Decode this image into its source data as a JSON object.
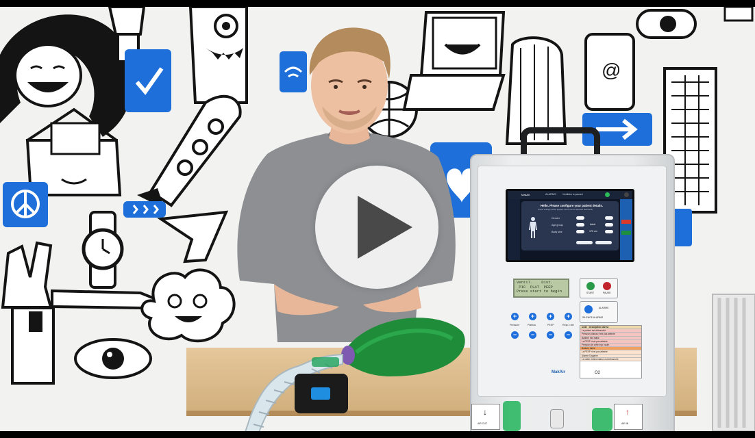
{
  "video": {
    "play_button_label": "Play video"
  },
  "device": {
    "screen": {
      "header_brand": "MakAir",
      "header_mode": "ALARMS",
      "header_status": "Ventilator is paused",
      "dialog_title": "Hello. Please configure your patient details.",
      "dialog_sub": "Preset settings will be applied, which can be adjusted afterwards.",
      "rows": [
        "Gender",
        "Age group",
        "Body size"
      ],
      "values": [
        "Adult",
        "170 cm"
      ]
    },
    "lcd_text": "Ventil.    Dist.\n PIC  PLAT  PEEP\nPress start to begin",
    "buttons": {
      "start_label": "START",
      "pause_label": "PAUSE",
      "alarms_label": "ALARMS",
      "silence_label": "SILENCE ALARMS"
    },
    "knobs": [
      "Pressure",
      "Plateau",
      "PEEP",
      "Resp. rate"
    ],
    "brand": "MakAir",
    "oxygen_label": "O2",
    "inlet_label": "AIR OUT",
    "outlet_label": "AIR IN",
    "label_sheet": {
      "header_left": "Code",
      "header_right": "Description alarme",
      "lines": [
        "Le patient est débranché",
        "Pression plateau n'est pas atteinte",
        "Batterie très faible",
        "La PEEP n'est pas atteinte",
        "Pression de crête trop haute",
        "Batterie faible",
        "La PEEP n'est pas atteinte",
        "Alarme Oxygène",
        "Le câble d'alimentation est débranché"
      ]
    }
  },
  "colors": {
    "wall": "#f2f2f0",
    "accent_blue": "#1e6fd9",
    "bag_green": "#1f8c3a",
    "sweater": "#8d8f93"
  }
}
